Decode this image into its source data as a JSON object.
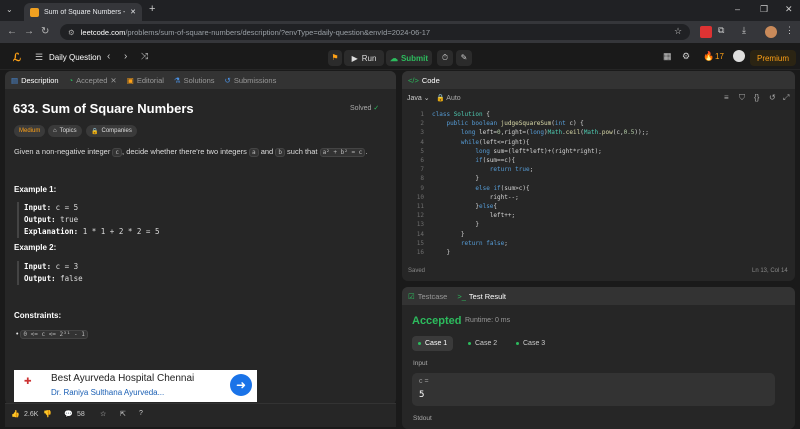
{
  "browser": {
    "tab_title": "Sum of Square Numbers - Leet",
    "new_tab": "+",
    "url_host": "leetcode.com",
    "url_path": "/problems/sum-of-square-numbers/description/?envType=daily-question&envId=2024-06-17",
    "window_min": "–",
    "window_max": "❐",
    "window_close": "✕"
  },
  "nav": {
    "daily_label": "Daily Question",
    "run_label": "Run",
    "submit_label": "Submit",
    "streak": "17",
    "premium_label": "Premium"
  },
  "problem_tabs": [
    "Description",
    "Accepted",
    "Editorial",
    "Solutions",
    "Submissions"
  ],
  "problem": {
    "title": "633. Sum of Square Numbers",
    "solved": "Solved",
    "difficulty": "Medium",
    "topics": "Topics",
    "companies": "Companies",
    "desc_a": "Given a non-negative integer",
    "desc_c": "c",
    "desc_b": ", decide whether there're two integers",
    "desc_var_a": "a",
    "desc_and": "and",
    "desc_var_b": "b",
    "desc_end": "such that",
    "desc_formula": "a² + b² = c",
    "desc_period": ".",
    "example1_heading": "Example 1:",
    "example1": {
      "input_label": "Input:",
      "input_value": "c = 5",
      "output_label": "Output:",
      "output_value": "true",
      "expl_label": "Explanation:",
      "expl_value": "1 * 1 + 2 * 2 = 5"
    },
    "example2_heading": "Example 2:",
    "example2": {
      "input_label": "Input:",
      "input_value": "c = 3",
      "output_label": "Output:",
      "output_value": "false"
    },
    "constraints_heading": "Constraints:",
    "constraint": "0 <= c <= 2³¹ - 1"
  },
  "ad": {
    "title": "Best Ayurveda Hospital Chennai",
    "subtitle": "Dr. Raniya Sulthana Ayurveda..."
  },
  "bottom": {
    "likes": "2.6K",
    "comments": "58"
  },
  "code_panel": {
    "title": "Code",
    "language": "Java",
    "auto": "Auto",
    "saved": "Saved",
    "cursor": "Ln 13, Col 14",
    "lines": [
      "class Solution {",
      "    public boolean judgeSquareSum(int c) {",
      "        long left=0,right=(long)Math.ceil(Math.pow(c,0.5));;",
      "        while(left<=right){",
      "            long sum=(left*left)+(right*right);",
      "            if(sum==c){",
      "                return true;",
      "            }",
      "            else if(sum>c){",
      "                right--;",
      "            }else{",
      "                left++;",
      "            }",
      "        }",
      "        return false;",
      "    }"
    ]
  },
  "result_panel": {
    "testcase_tab": "Testcase",
    "result_tab": "Test Result",
    "status": "Accepted",
    "runtime": "Runtime: 0 ms",
    "cases": [
      "Case 1",
      "Case 2",
      "Case 3"
    ],
    "input_label": "Input",
    "input_var": "c =",
    "input_value": "5",
    "stdout_label": "Stdout"
  },
  "colors": {
    "accent": "#ffa116",
    "green": "#2cbb5d"
  }
}
